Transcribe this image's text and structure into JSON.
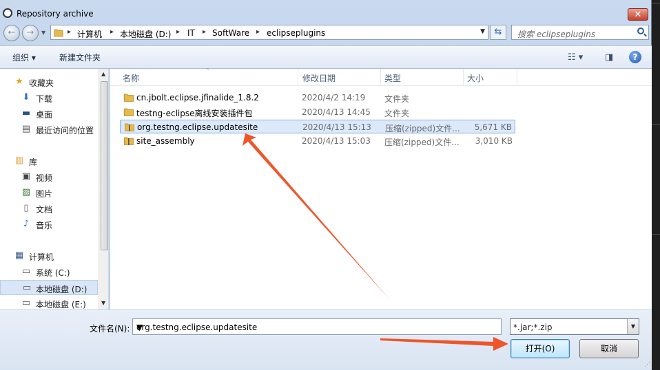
{
  "window": {
    "title": "Repository archive",
    "close_glyph": "✕"
  },
  "address": {
    "crumbs": [
      "计算机",
      "本地磁盘 (D:)",
      "IT",
      "SoftWare",
      "eclipseplugins"
    ],
    "separator": "▸",
    "search_placeholder": "搜索 eclipseplugins"
  },
  "toolbar": {
    "organize": "组织 ▾",
    "new_folder": "新建文件夹",
    "help": "?"
  },
  "nav": {
    "items": [
      {
        "label": "收藏夹",
        "icon": "star-icon",
        "glyph": "★",
        "color": "#e8a317"
      },
      {
        "label": "下载",
        "icon": "download-folder-icon",
        "glyph": "⬇",
        "color": "#2a6fc9"
      },
      {
        "label": "桌面",
        "icon": "desktop-icon",
        "glyph": "▬",
        "color": "#2a4f8a"
      },
      {
        "label": "最近访问的位置",
        "icon": "recent-places-icon",
        "glyph": "▤",
        "color": "#555"
      },
      {
        "label": "库",
        "icon": "library-icon",
        "glyph": "▥",
        "color": "#d89b2c"
      },
      {
        "label": "视频",
        "icon": "video-icon",
        "glyph": "▣",
        "color": "#444"
      },
      {
        "label": "图片",
        "icon": "pictures-icon",
        "glyph": "▨",
        "color": "#3b7a3b"
      },
      {
        "label": "文档",
        "icon": "documents-icon",
        "glyph": "▯",
        "color": "#666"
      },
      {
        "label": "音乐",
        "icon": "music-icon",
        "glyph": "♪",
        "color": "#2a6fc9"
      },
      {
        "label": "计算机",
        "icon": "computer-icon",
        "glyph": "▦",
        "color": "#3a5a8a"
      },
      {
        "label": "系统 (C:)",
        "icon": "system-drive-icon",
        "glyph": "▭",
        "color": "#555"
      },
      {
        "label": "本地磁盘 (D:)",
        "icon": "drive-icon",
        "glyph": "▭",
        "color": "#555"
      },
      {
        "label": "本地磁盘 (E:)",
        "icon": "drive-icon",
        "glyph": "▭",
        "color": "#555"
      }
    ]
  },
  "columns": [
    "名称",
    "修改日期",
    "类型",
    "大小"
  ],
  "files": [
    {
      "name": "cn.jbolt.eclipse.jfinalide_1.8.2",
      "date": "2020/4/2 14:19",
      "type": "文件夹",
      "size": "",
      "kind": "folder"
    },
    {
      "name": "testng-eclipse离线安装插件包",
      "date": "2020/4/13 14:45",
      "type": "文件夹",
      "size": "",
      "kind": "folder"
    },
    {
      "name": "org.testng.eclipse.updatesite",
      "date": "2020/4/13 15:13",
      "type": "压缩(zipped)文件...",
      "size": "5,671 KB",
      "kind": "zip"
    },
    {
      "name": "site_assembly",
      "date": "2020/4/13 15:03",
      "type": "压缩(zipped)文件...",
      "size": "3,010 KB",
      "kind": "zip"
    }
  ],
  "selected_row": 2,
  "filename": {
    "label": "文件名(N):",
    "value": "org.testng.eclipse.updatesite"
  },
  "filter": {
    "value": "*.jar;*.zip"
  },
  "buttons": {
    "open": "打开(O)",
    "cancel": "取消"
  },
  "colors": {
    "arrow": "#f0552a",
    "selection": "#dbe9fb",
    "folder": "#e9b949"
  }
}
